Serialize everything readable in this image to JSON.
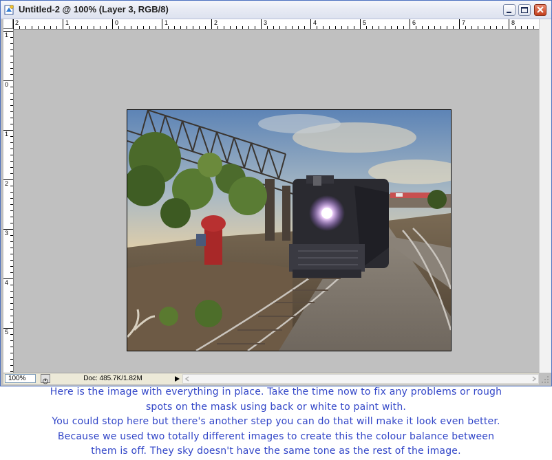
{
  "window": {
    "title": "Untitled-2 @ 100% (Layer 3, RGB/8)",
    "icon": "photoshop-document-icon",
    "controls": [
      "minimize-icon",
      "maximize-icon",
      "close-icon"
    ]
  },
  "rulers": {
    "horizontal_labels": [
      "2",
      "1",
      "0",
      "1",
      "2",
      "3",
      "4",
      "5",
      "6",
      "7",
      "8"
    ],
    "vertical_labels": [
      "1",
      "0",
      "1",
      "2",
      "3",
      "4",
      "5"
    ]
  },
  "canvas": {
    "background_color": "#c0c0c0",
    "image_description_icon": "train-photo-composite"
  },
  "statusbar": {
    "zoom": "100%",
    "doc_info": "Doc: 485.7K/1.82M"
  },
  "caption": {
    "color": "#3246c8",
    "lines": [
      "Here is the image with everything in place. Take the time now to fix any problems or rough",
      "spots on the mask using back or white to paint with.",
      "You could stop here but there's another step you can do that will make it look even better.",
      "Because we used two totally different images to create this the colour balance between",
      "them is off. They sky doesn't have the same tone as the rest of the image."
    ]
  }
}
